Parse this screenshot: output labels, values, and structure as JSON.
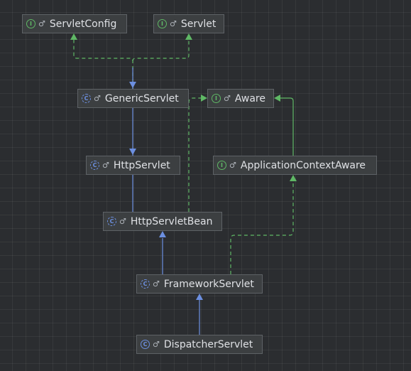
{
  "colors": {
    "background": "#2b2d30",
    "grid": "#35373a",
    "node_fill": "#3c3f41",
    "node_border": "#5e6266",
    "text": "#dfe1e5",
    "extends_edge": "#6c8fe0",
    "implements_edge": "#5fb865"
  },
  "nodes": {
    "servlet_config": {
      "label": "ServletConfig",
      "kind": "interface",
      "badge": "I",
      "vis": "♂"
    },
    "servlet": {
      "label": "Servlet",
      "kind": "interface",
      "badge": "I",
      "vis": "♂"
    },
    "generic_servlet": {
      "label": "GenericServlet",
      "kind": "abstract",
      "badge": "C",
      "vis": "♂"
    },
    "aware": {
      "label": "Aware",
      "kind": "interface",
      "badge": "I",
      "vis": "♂"
    },
    "http_servlet": {
      "label": "HttpServlet",
      "kind": "abstract",
      "badge": "C",
      "vis": "♂"
    },
    "application_context_aware": {
      "label": "ApplicationContextAware",
      "kind": "interface",
      "badge": "I",
      "vis": "♂"
    },
    "http_servlet_bean": {
      "label": "HttpServletBean",
      "kind": "abstract",
      "badge": "C",
      "vis": "♂"
    },
    "framework_servlet": {
      "label": "FrameworkServlet",
      "kind": "abstract",
      "badge": "C",
      "vis": "♂"
    },
    "dispatcher_servlet": {
      "label": "DispatcherServlet",
      "kind": "class",
      "badge": "C",
      "vis": "♂"
    }
  },
  "edges": [
    {
      "from": "generic_servlet",
      "to": "servlet_config",
      "type": "implements"
    },
    {
      "from": "generic_servlet",
      "to": "servlet",
      "type": "implements"
    },
    {
      "from": "http_servlet",
      "to": "generic_servlet",
      "type": "extends"
    },
    {
      "from": "http_servlet_bean",
      "to": "http_servlet",
      "type": "extends"
    },
    {
      "from": "http_servlet_bean",
      "to": "aware",
      "type": "implements"
    },
    {
      "from": "application_context_aware",
      "to": "aware",
      "type": "extends-interface"
    },
    {
      "from": "framework_servlet",
      "to": "http_servlet_bean",
      "type": "extends"
    },
    {
      "from": "framework_servlet",
      "to": "application_context_aware",
      "type": "implements"
    },
    {
      "from": "dispatcher_servlet",
      "to": "framework_servlet",
      "type": "extends"
    }
  ]
}
